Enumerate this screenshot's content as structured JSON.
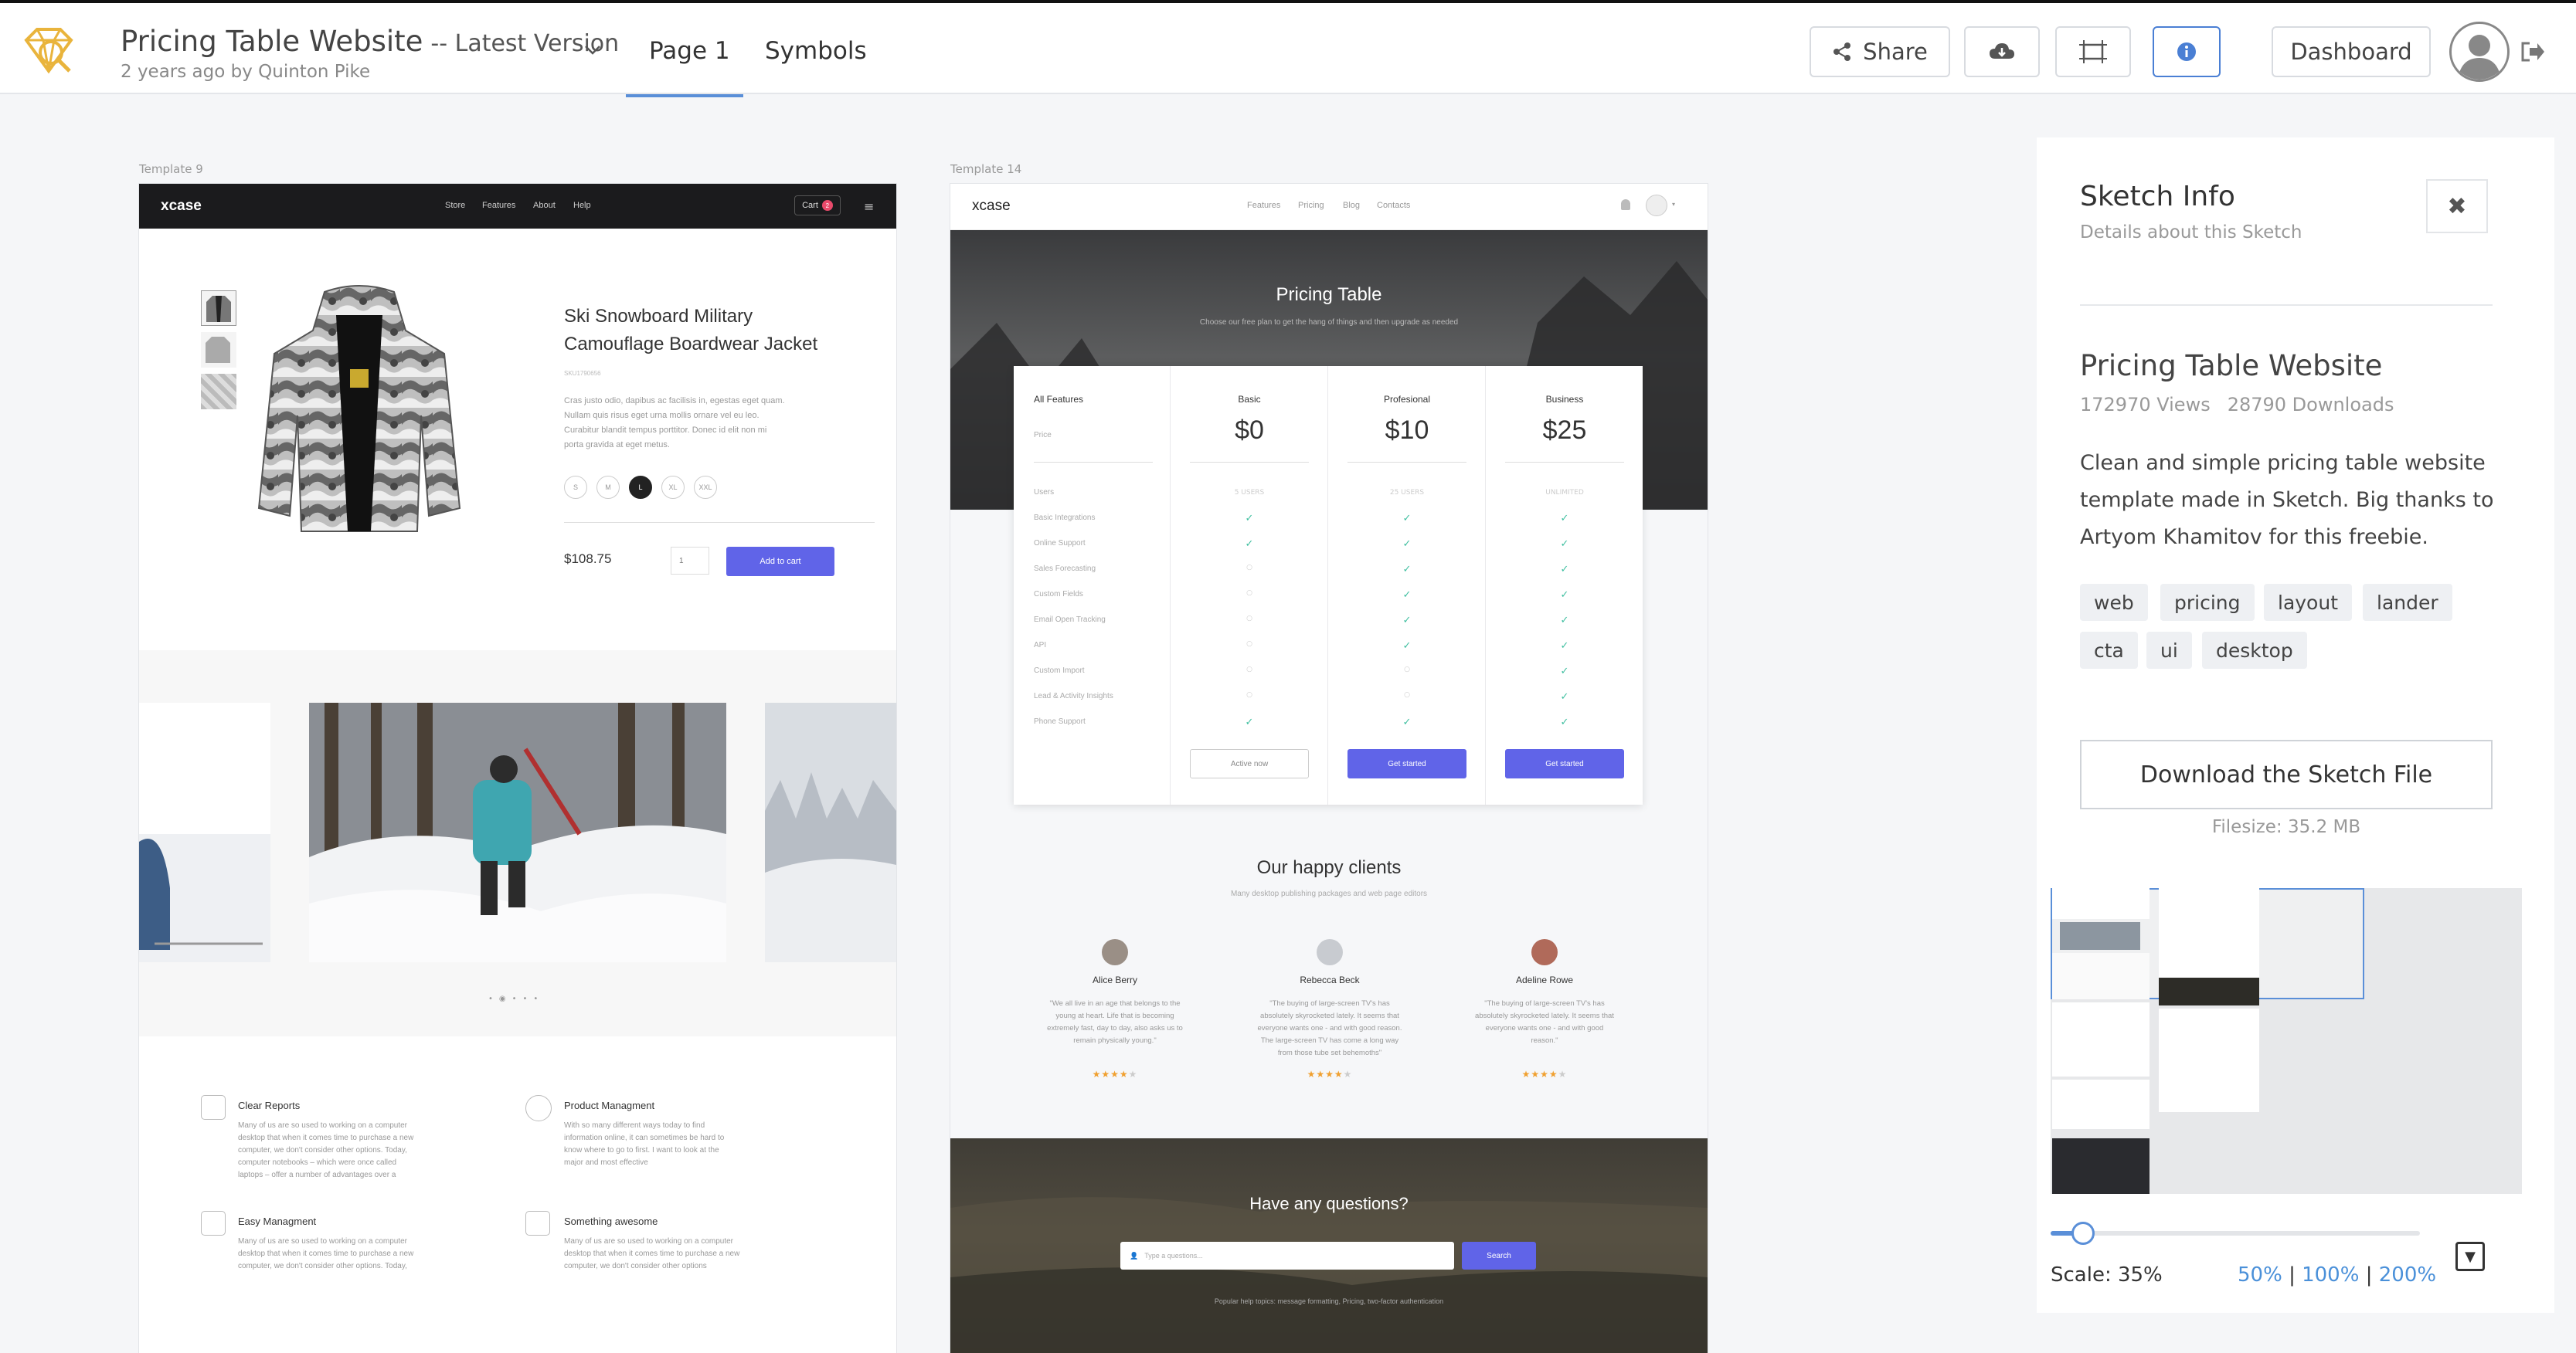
{
  "header": {
    "title": "Pricing Table Website",
    "version": "-- Latest Version",
    "subtitle": "2 years ago by Quinton Pike",
    "tabs": [
      "Page 1",
      "Symbols"
    ],
    "share_label": "Share",
    "dashboard_label": "Dashboard"
  },
  "template9": {
    "label": "Template 9",
    "nav": {
      "logo": "xcase",
      "links": [
        "Store",
        "Features",
        "About",
        "Help"
      ],
      "cart": "Cart",
      "cart_count": "2"
    },
    "product": {
      "title_line1": "Ski Snowboard Military",
      "title_line2": "Camouflage Boardwear Jacket",
      "sku": "SKU1790656",
      "desc": [
        "Cras justo odio, dapibus ac facilisis in, egestas eget quam.",
        "Nullam quis risus eget urna mollis ornare vel eu leo.",
        "Curabitur blandit tempus porttitor. Donec id elit non mi",
        "porta gravida at eget metus."
      ],
      "sizes": [
        "S",
        "M",
        "L",
        "XL",
        "XXL"
      ],
      "price": "$108.75",
      "qty": "1",
      "add_to_cart": "Add to cart"
    },
    "features": [
      {
        "title": "Clear Reports",
        "lines": [
          "Many of us are so used to working on a computer",
          "desktop that when it comes time to purchase a new",
          "computer, we don't consider other options. Today,",
          "computer notebooks – which were once called",
          "laptops – offer a number of advantages over a"
        ]
      },
      {
        "title": "Product Managment",
        "lines": [
          "With so many different ways today to find",
          "information online, it can sometimes be hard to",
          "know where to go to first. I want to look at the",
          "major and most effective"
        ]
      },
      {
        "title": "Easy Managment",
        "lines": [
          "Many of us are so used to working on a computer",
          "desktop that when it comes time to purchase a new",
          "computer, we don't consider other options. Today,"
        ]
      },
      {
        "title": "Something awesome",
        "lines": [
          "Many of us are so used to working on a computer",
          "desktop that when it comes time to purchase a new",
          "computer, we don't consider other options"
        ]
      }
    ]
  },
  "template14": {
    "label": "Template 14",
    "nav": {
      "logo": "xcase",
      "links": [
        "Features",
        "Pricing",
        "Blog",
        "Contacts"
      ]
    },
    "hero": {
      "title": "Pricing Table",
      "subtitle": "Choose our free plan to get the hang of things and then upgrade as needed"
    },
    "pricing": {
      "features_header": "All Features",
      "price_label": "Price",
      "plans": [
        {
          "name": "Basic",
          "price": "$0",
          "users": "5 USERS",
          "button": "Active now"
        },
        {
          "name": "Profesional",
          "price": "$10",
          "users": "25 USERS",
          "button": "Get started"
        },
        {
          "name": "Business",
          "price": "$25",
          "users": "UNLIMITED",
          "button": "Get started"
        }
      ],
      "feature_rows": [
        "Users",
        "Basic Integrations",
        "Online Support",
        "Sales Forecasting",
        "Custom Fields",
        "Email Open Tracking",
        "API",
        "Custom Import",
        "Lead & Activity Insights",
        "Phone Support"
      ],
      "checks": {
        "basic": [
          1,
          1,
          0,
          0,
          0,
          0,
          0,
          0,
          1
        ],
        "pro": [
          1,
          1,
          1,
          1,
          1,
          1,
          0,
          0,
          1
        ],
        "business": [
          1,
          1,
          1,
          1,
          1,
          1,
          1,
          1,
          1
        ]
      }
    },
    "clients": {
      "title": "Our happy clients",
      "subtitle": "Many desktop publishing packages and web page editors",
      "items": [
        {
          "name": "Alice Berry",
          "quote": [
            "\"We all live in an age that belongs to the",
            "young at heart. Life that is becoming",
            "extremely fast, day to day, also asks us to",
            "remain physically young.\""
          ]
        },
        {
          "name": "Rebecca Beck",
          "quote": [
            "\"The buying of large-screen TV's has",
            "absolutely skyrocketed lately. It seems that",
            "everyone wants one - and with good reason.",
            "The large-screen TV has come a long way",
            "from those tube set behemoths\""
          ]
        },
        {
          "name": "Adeline Rowe",
          "quote": [
            "\"The buying of large-screen TV's has",
            "absolutely skyrocketed lately. It seems that",
            "everyone wants one - and with good",
            "reason.\""
          ]
        }
      ]
    },
    "questions": {
      "title": "Have any questions?",
      "placeholder": "Type a questions...",
      "search": "Search",
      "footer": "Popular help topics: message formatting, Pricing, two-factor authentication"
    }
  },
  "panel": {
    "title": "Sketch Info",
    "subtitle": "Details about this Sketch",
    "sketch_title": "Pricing Table Website",
    "views": "172970 Views",
    "downloads": "28790 Downloads",
    "desc_lines": [
      "Clean and simple pricing table website",
      "template made in Sketch. Big thanks to",
      "Artyom Khamitov for this freebie."
    ],
    "tags": [
      "web",
      "pricing",
      "layout",
      "lander",
      "cta",
      "ui",
      "desktop"
    ],
    "download_label": "Download the Sketch File",
    "filesize": "Filesize: 35.2 MB",
    "scale_label": "Scale: 35%",
    "scale_value_pct": 35,
    "zoom_50": "50%",
    "zoom_100": "100%",
    "zoom_200": "200%",
    "sep": "|"
  },
  "colors": {
    "accent": "#6064e8",
    "check": "#3fbfa0",
    "link": "#4a90d9"
  }
}
